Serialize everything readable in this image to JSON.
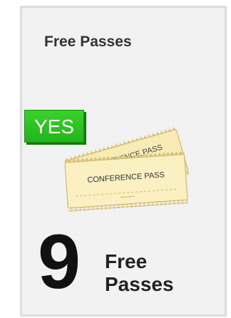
{
  "card": {
    "title": "Free Passes",
    "badge": "YES",
    "pass_labels": [
      "CONFERENCE PASS",
      "CONFERENCE PASS"
    ],
    "count": "9",
    "count_label": "Free Passes"
  },
  "colors": {
    "badge": "#2fc124",
    "ticket": "#fbf0c2",
    "ticket_edge": "#d9c27b",
    "card_bg": "#f2f2f2"
  },
  "icons": {
    "passes": "conference-pass-tickets-icon"
  }
}
